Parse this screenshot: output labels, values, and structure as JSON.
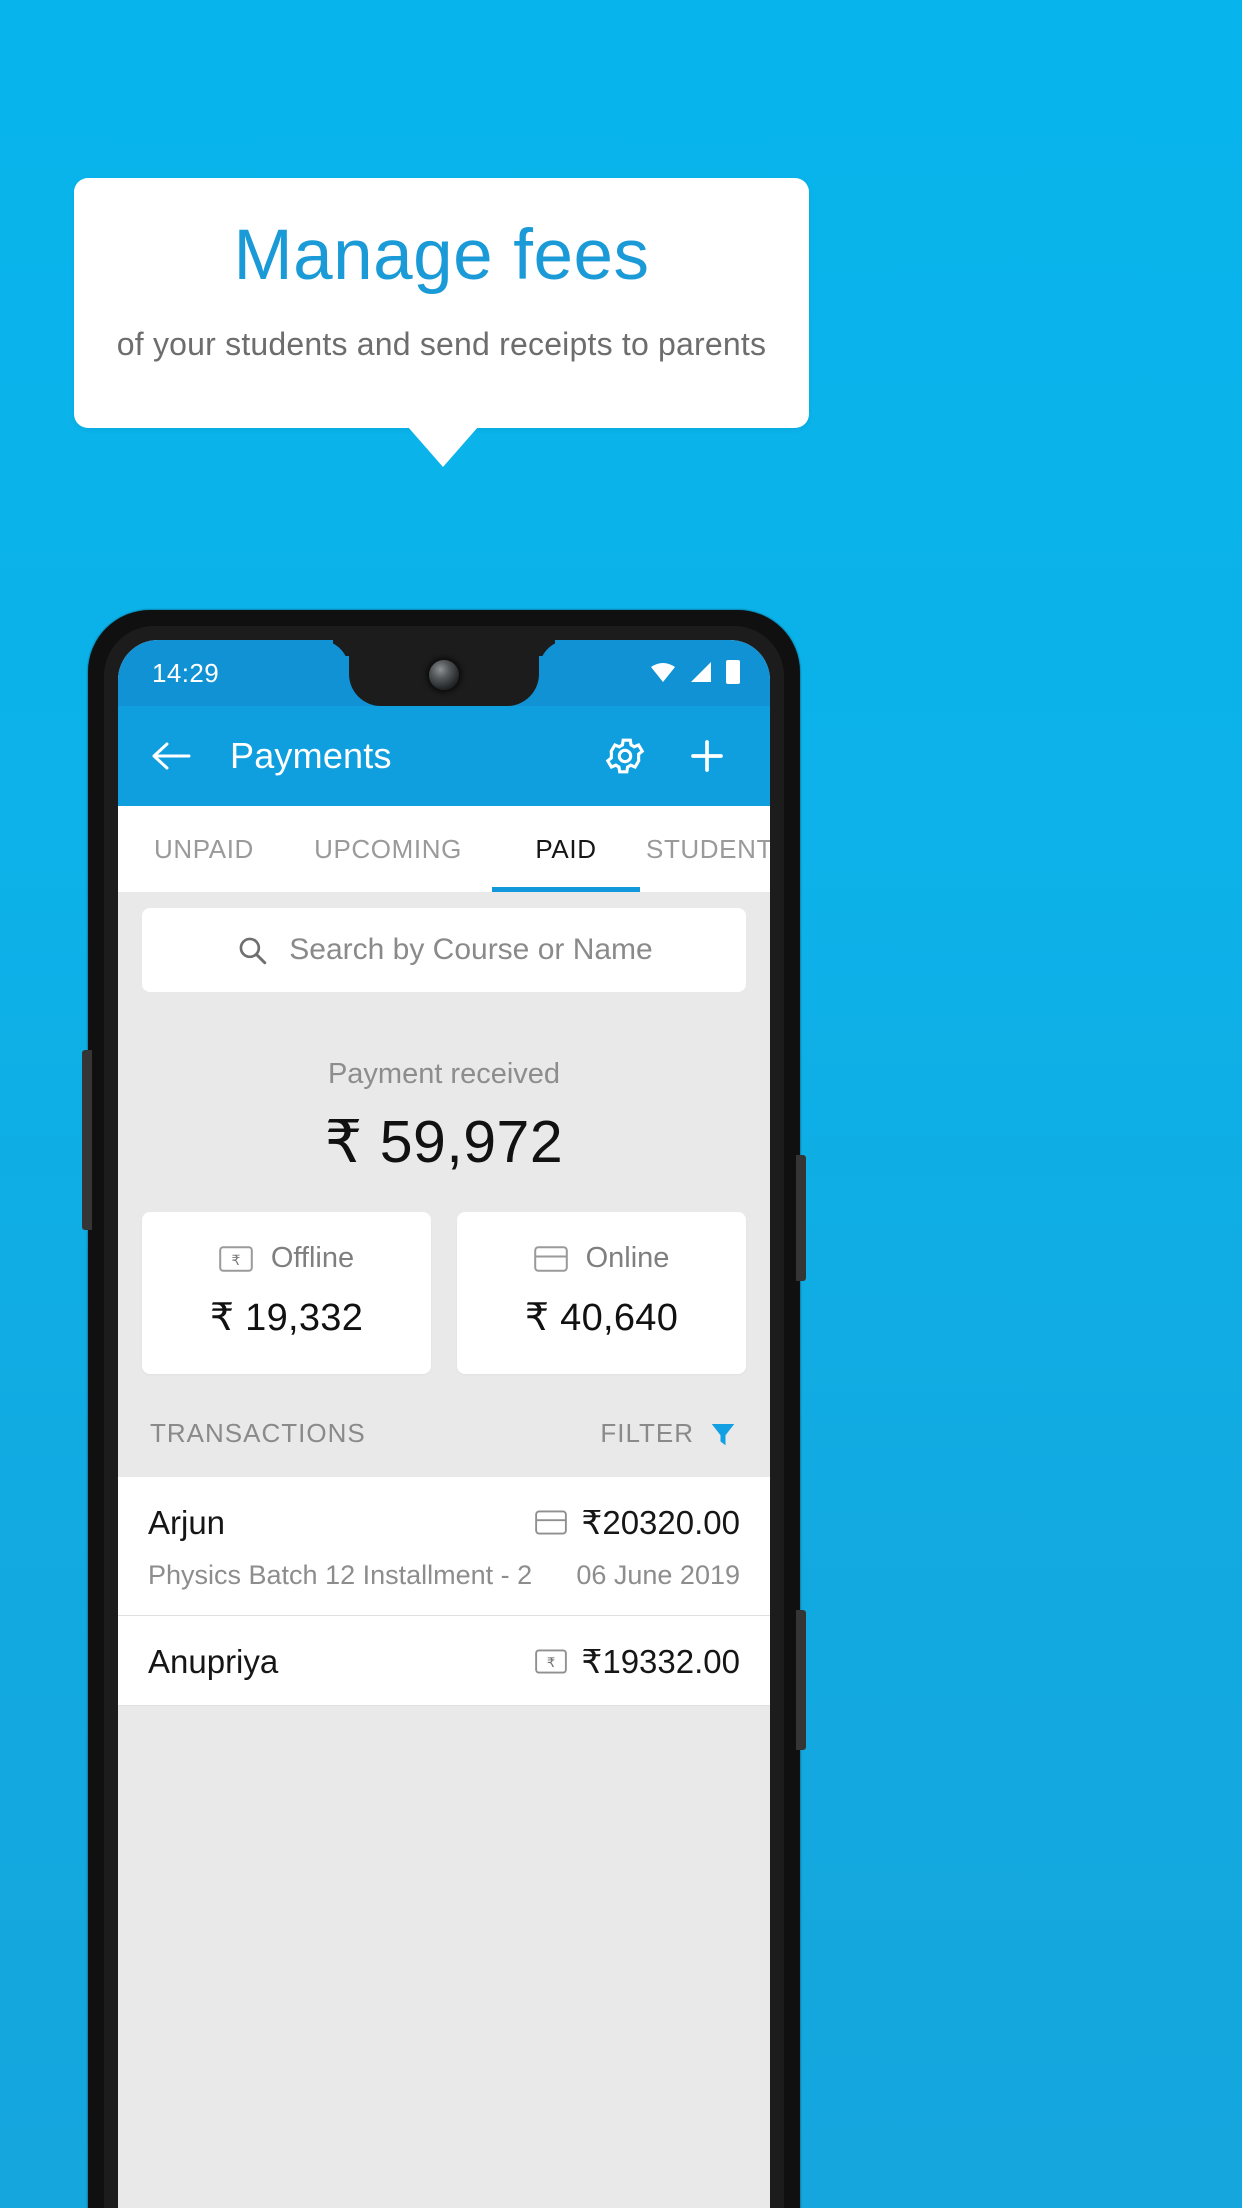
{
  "promo": {
    "title": "Manage fees",
    "subtitle": "of your students and send receipts to parents",
    "title_color": "#1a9ad7",
    "background_color": "#0cb2e9"
  },
  "phone": {
    "status_bar": {
      "time": "14:29",
      "icons": [
        "wifi-icon",
        "signal-icon",
        "battery-icon"
      ]
    },
    "app_bar": {
      "back_icon": "back-arrow-icon",
      "title": "Payments",
      "settings_icon": "gear-icon",
      "add_icon": "plus-icon",
      "color": "#0f9fdf"
    },
    "tabs": [
      {
        "label": "UNPAID",
        "active": false
      },
      {
        "label": "UPCOMING",
        "active": false
      },
      {
        "label": "PAID",
        "active": true
      },
      {
        "label": "STUDENTS",
        "active": false
      }
    ],
    "search": {
      "icon": "search-icon",
      "placeholder": "Search by Course or Name",
      "value": ""
    },
    "summary": {
      "label": "Payment received",
      "amount": "₹ 59,972",
      "cards": [
        {
          "icon": "banknote-rupee-icon",
          "label": "Offline",
          "amount": "₹ 19,332"
        },
        {
          "icon": "credit-card-icon",
          "label": "Online",
          "amount": "₹ 40,640"
        }
      ]
    },
    "transactions_header": {
      "title": "TRANSACTIONS",
      "filter_label": "FILTER",
      "filter_icon": "funnel-icon",
      "filter_color": "#12a0e3"
    },
    "transactions": [
      {
        "name": "Arjun",
        "method_icon": "credit-card-icon",
        "amount": "₹20320.00",
        "description": "Physics Batch 12 Installment - 2",
        "date": "06 June 2019"
      },
      {
        "name": "Anupriya",
        "method_icon": "banknote-rupee-icon",
        "amount": "₹19332.00",
        "description": "",
        "date": ""
      }
    ]
  }
}
